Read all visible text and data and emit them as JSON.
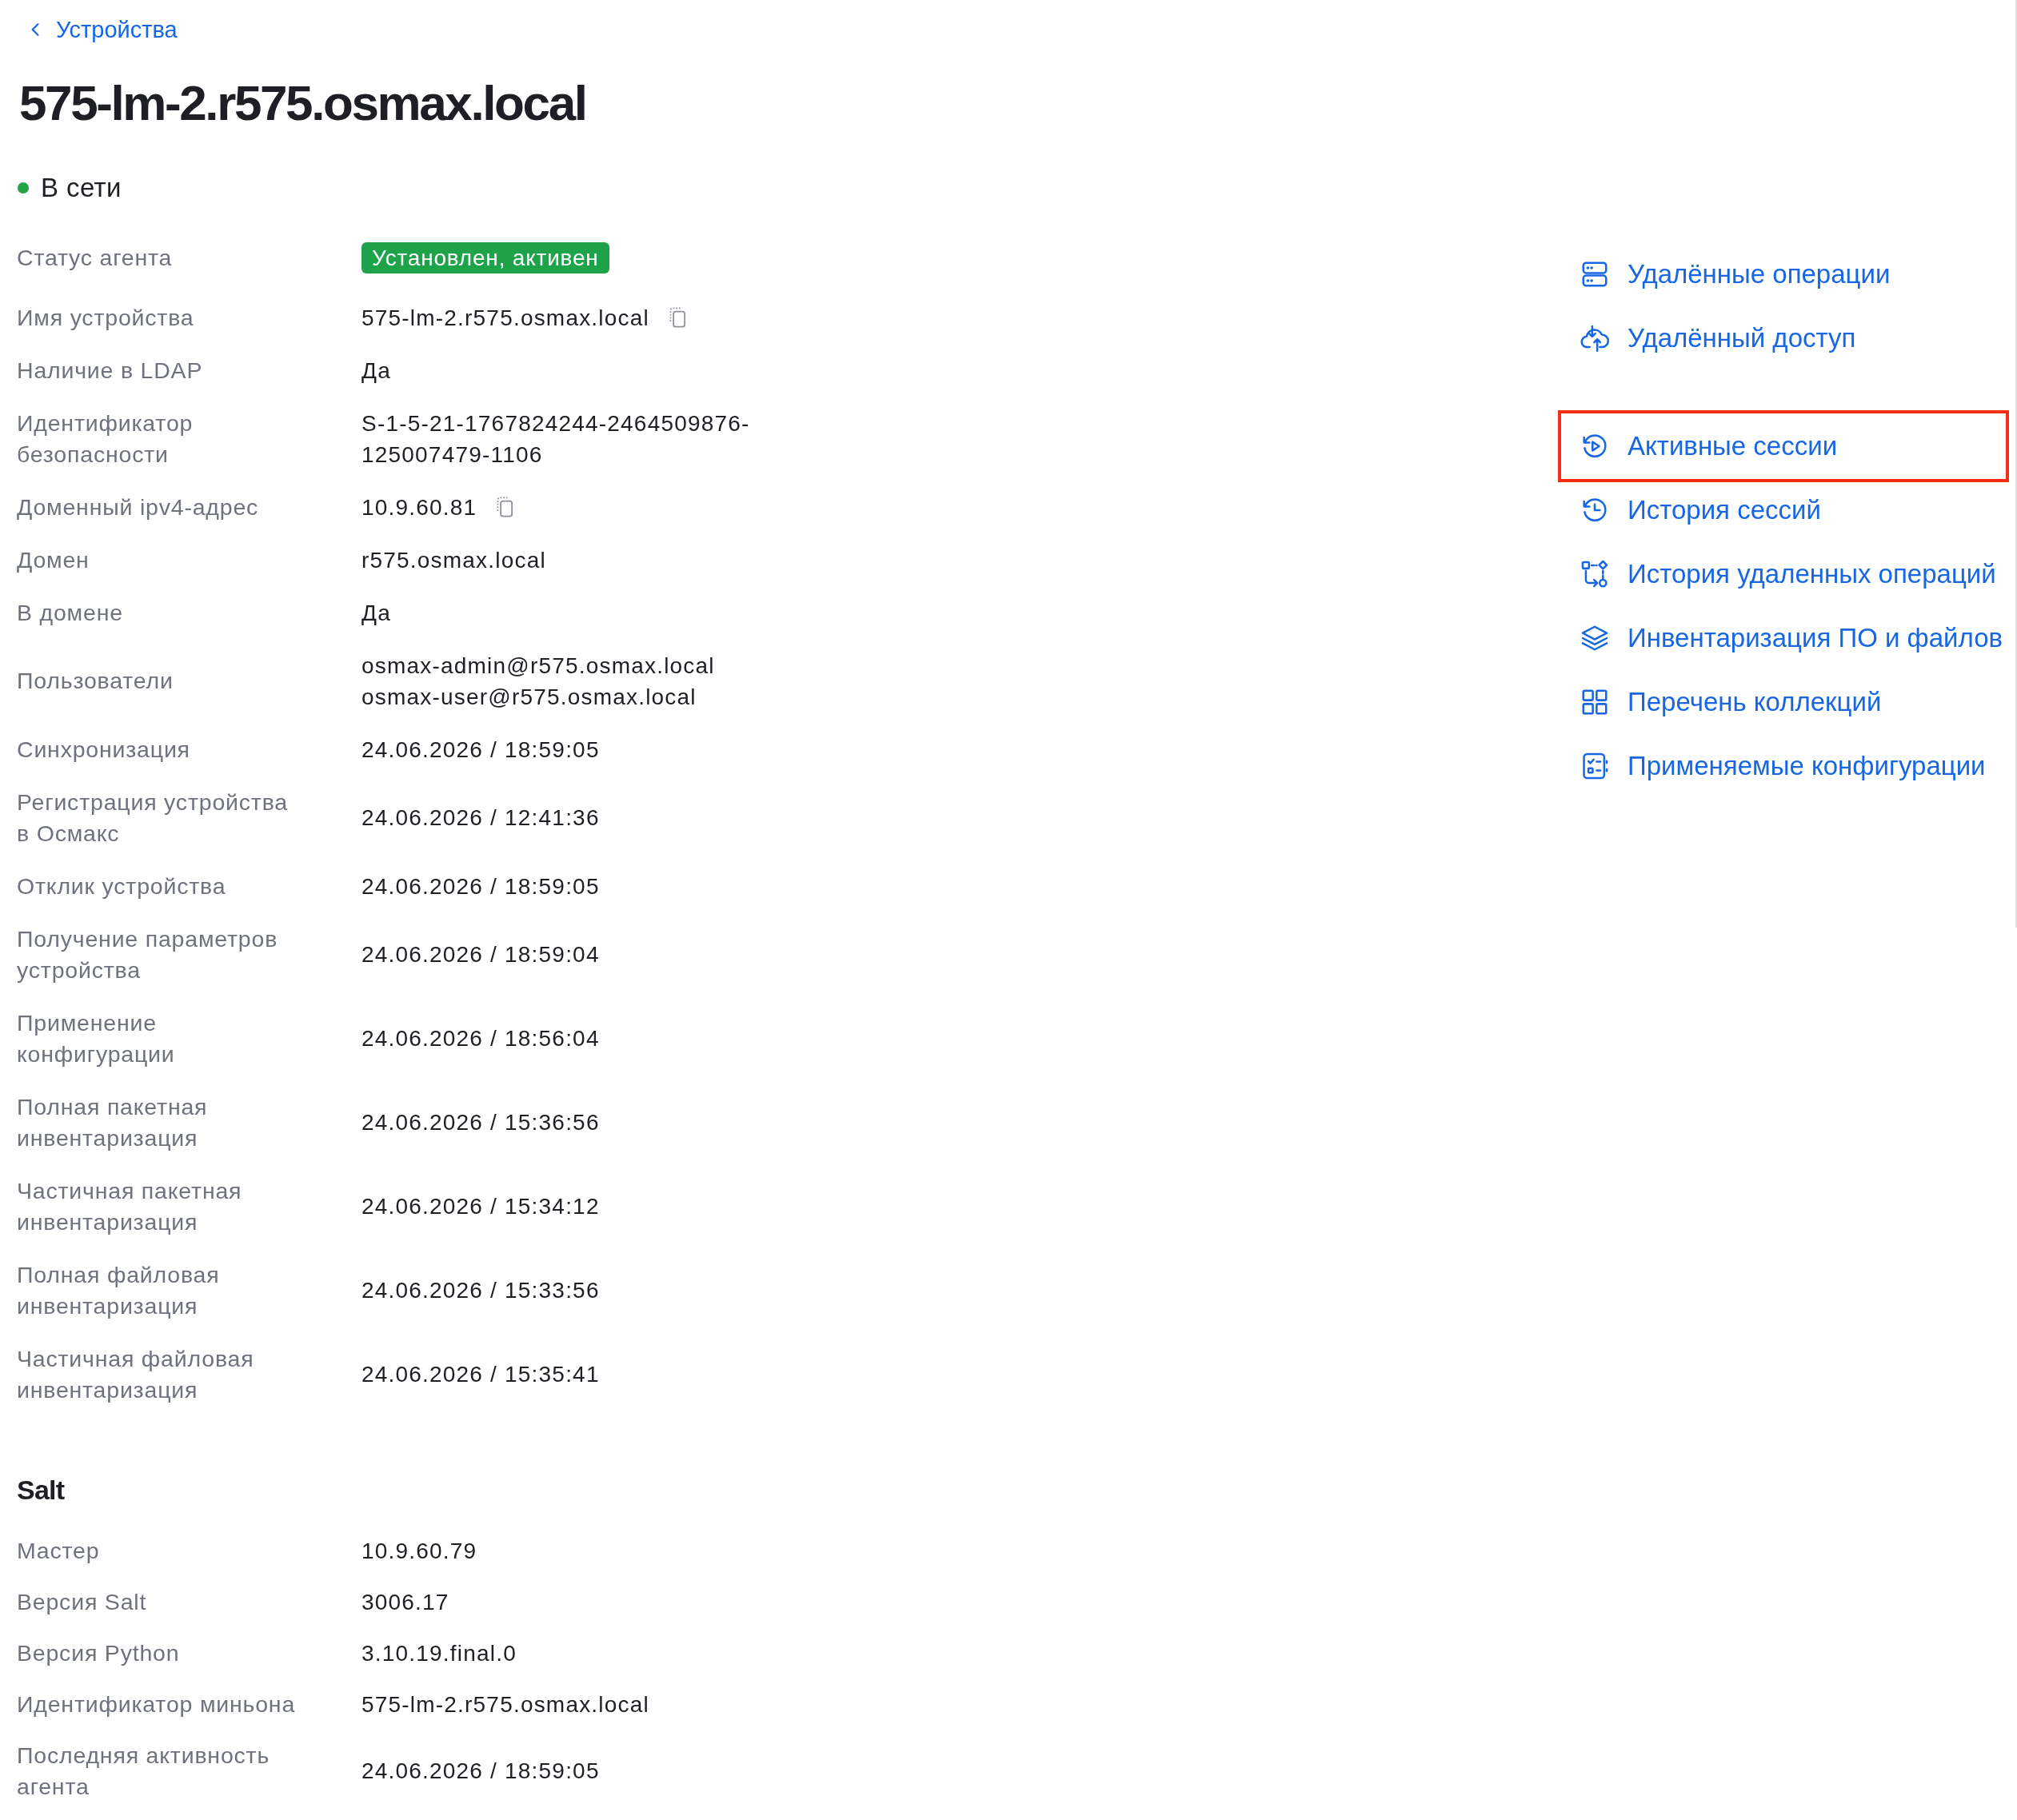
{
  "back_link": {
    "label": "Устройства"
  },
  "title": "575-lm-2.r575.osmax.local",
  "status": {
    "label": "В сети",
    "online": true
  },
  "details": [
    {
      "label": "Статус агента",
      "kind": "badge",
      "value": "Установлен, активен",
      "copyable": false
    },
    {
      "label": "Имя устройства",
      "kind": "text",
      "value": "575-lm-2.r575.osmax.local",
      "copyable": true
    },
    {
      "label": "Наличие в LDAP",
      "kind": "text",
      "value": "Да",
      "copyable": false
    },
    {
      "label": "Идентификатор безопасности",
      "kind": "text",
      "value": "S-1-5-21-1767824244-2464509876-125007479-1106",
      "copyable": false
    },
    {
      "label": "Доменный ipv4-адрес",
      "kind": "text",
      "value": "10.9.60.81",
      "copyable": true
    },
    {
      "label": "Домен",
      "kind": "text",
      "value": "r575.osmax.local",
      "copyable": false
    },
    {
      "label": "В домене",
      "kind": "text",
      "value": "Да",
      "copyable": false
    },
    {
      "label": "Пользователи",
      "kind": "lines",
      "values": [
        "osmax-admin@r575.osmax.local",
        "osmax-user@r575.osmax.local"
      ],
      "copyable": false
    },
    {
      "label": "Синхронизация",
      "kind": "text",
      "value": "24.06.2026 / 18:59:05",
      "copyable": false
    },
    {
      "label": "Регистрация устройства в Осмакс",
      "kind": "text",
      "value": "24.06.2026 / 12:41:36",
      "copyable": false
    },
    {
      "label": "Отклик устройства",
      "kind": "text",
      "value": "24.06.2026 / 18:59:05",
      "copyable": false
    },
    {
      "label": "Получение параметров устройства",
      "kind": "text",
      "value": "24.06.2026 / 18:59:04",
      "copyable": false
    },
    {
      "label": "Применение конфигурации",
      "kind": "text",
      "value": "24.06.2026 / 18:56:04",
      "copyable": false
    },
    {
      "label": "Полная пакетная инвентаризация",
      "kind": "text",
      "value": "24.06.2026 / 15:36:56",
      "copyable": false
    },
    {
      "label": "Частичная пакетная инвентаризация",
      "kind": "text",
      "value": "24.06.2026 / 15:34:12",
      "copyable": false
    },
    {
      "label": "Полная файловая инвентаризация",
      "kind": "text",
      "value": "24.06.2026 / 15:33:56",
      "copyable": false
    },
    {
      "label": "Частичная файловая инвентаризация",
      "kind": "text",
      "value": "24.06.2026 / 15:35:41",
      "copyable": false
    }
  ],
  "salt": {
    "title": "Salt",
    "rows": [
      {
        "label": "Мастер",
        "kind": "text",
        "value": "10.9.60.79"
      },
      {
        "label": "Версия Salt",
        "kind": "text",
        "value": "3006.17"
      },
      {
        "label": "Версия Python",
        "kind": "text",
        "value": "3.10.19.final.0"
      },
      {
        "label": "Идентификатор миньона",
        "kind": "text",
        "value": "575-lm-2.r575.osmax.local"
      },
      {
        "label": "Последняя активность агента",
        "kind": "text",
        "value": "24.06.2026 / 18:59:05"
      }
    ]
  },
  "actions": {
    "groups": [
      {
        "items": [
          {
            "label": "Удалённые операции",
            "highlighted": false
          },
          {
            "label": "Удалённый доступ",
            "highlighted": false
          }
        ]
      },
      {
        "items": [
          {
            "label": "Активные сессии",
            "highlighted": true
          },
          {
            "label": "История сессий",
            "highlighted": false
          },
          {
            "label": "История удаленных операций",
            "highlighted": false
          },
          {
            "label": "Инвентаризация ПО и файлов",
            "highlighted": false
          },
          {
            "label": "Перечень коллекций",
            "highlighted": false
          },
          {
            "label": "Применяемые конфигурации",
            "highlighted": false
          }
        ]
      }
    ]
  }
}
